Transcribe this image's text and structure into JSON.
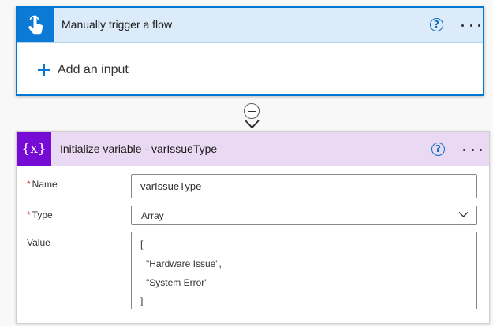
{
  "colors": {
    "trigger_accent": "#0078d4",
    "trigger_header_bg": "#dcebfa",
    "variable_accent": "#770bd6",
    "variable_header_bg": "#ead9f2",
    "required_star": "#d13438"
  },
  "trigger": {
    "title": "Manually trigger a flow",
    "icon": "touch-hand-icon",
    "add_input_label": "Add an input"
  },
  "connector": {
    "icon": "plus-icon",
    "arrow_icon": "arrow-down-icon"
  },
  "variable_action": {
    "title": "Initialize variable - varIssueType",
    "icon_text": "{x}",
    "icon": "variable-icon",
    "fields": {
      "name": {
        "label": "Name",
        "required_mark": "*",
        "value": "varIssueType"
      },
      "type": {
        "label": "Type",
        "required_mark": "*",
        "value": "Array"
      },
      "value": {
        "label": "Value",
        "lines": [
          "[",
          "\"Hardware Issue\",",
          "\"System Error\"",
          "]"
        ]
      }
    }
  }
}
